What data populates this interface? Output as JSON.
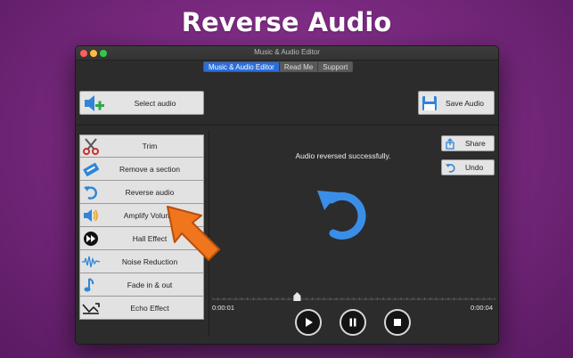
{
  "promo": {
    "title": "Reverse Audio"
  },
  "window": {
    "title": "Music & Audio Editor"
  },
  "tabs": [
    {
      "label": "Music & Audio Editor",
      "active": true
    },
    {
      "label": "Read Me",
      "active": false
    },
    {
      "label": "Support",
      "active": false
    }
  ],
  "toolbar": {
    "select_audio": "Select audio",
    "save_audio": "Save Audio"
  },
  "tools": [
    {
      "label": "Trim",
      "icon": "scissors-icon"
    },
    {
      "label": "Remove a section",
      "icon": "remove-tag-icon"
    },
    {
      "label": "Reverse audio",
      "icon": "undo-arrow-icon"
    },
    {
      "label": "Amplify Volume",
      "icon": "speaker-icon"
    },
    {
      "label": "Hall Effect",
      "icon": "fast-forward-icon"
    },
    {
      "label": "Noise Reduction",
      "icon": "waveform-icon"
    },
    {
      "label": "Fade in & out",
      "icon": "music-note-icon"
    },
    {
      "label": "Echo Effect",
      "icon": "echo-icon"
    }
  ],
  "status": {
    "message": "Audio reversed successfully."
  },
  "actions": {
    "share": "Share",
    "undo": "Undo"
  },
  "player": {
    "time_start": "0:00:01",
    "time_end": "0:00:04",
    "position": 0.3
  },
  "colors": {
    "accent": "#2b6ed9",
    "arrow": "#f0761d",
    "undo_blue": "#3a8ee8"
  }
}
